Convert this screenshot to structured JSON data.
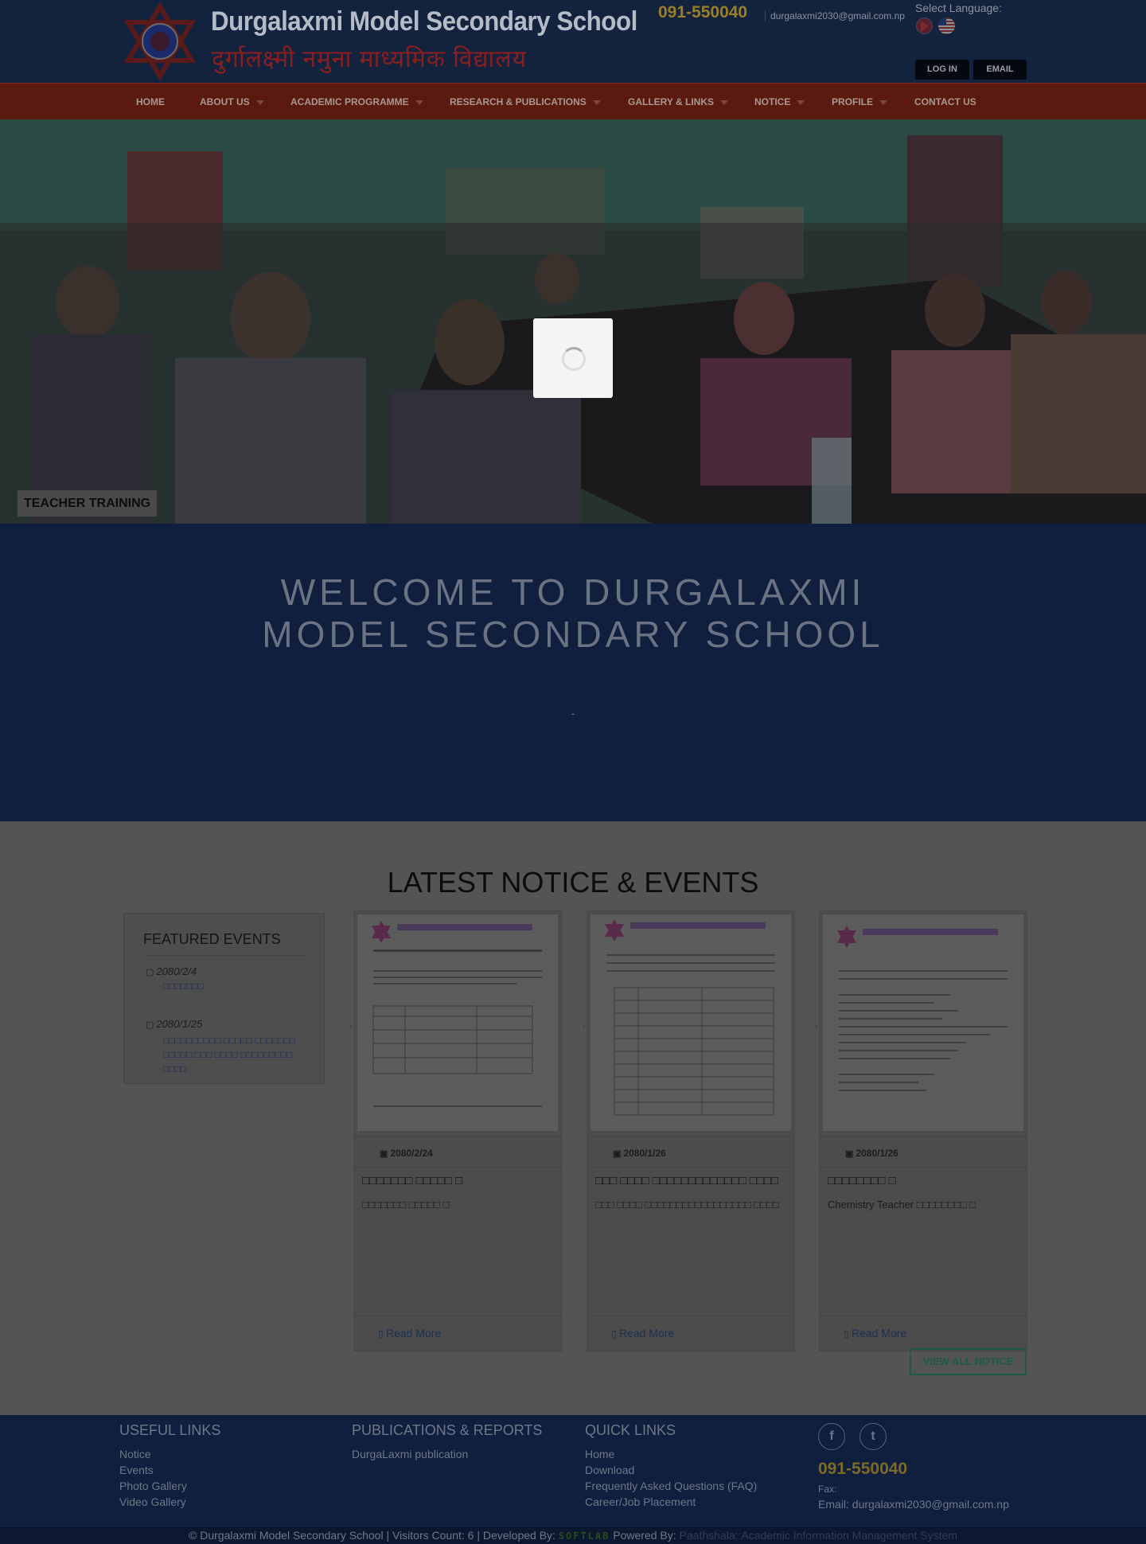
{
  "header": {
    "school_name_en": "Durgalaxmi Model Secondary School",
    "school_name_ne": "दुर्गालक्ष्मी नमुना माध्यमिक विद्यालय",
    "phone": "091-550040",
    "email": "durgalaxmi2030@gmail.com.np",
    "language_label": "Select Language:",
    "login_label": "LOG IN",
    "email_button_label": "EMAIL"
  },
  "nav": {
    "items": [
      {
        "label": "HOME",
        "has_dropdown": false
      },
      {
        "label": "ABOUT US",
        "has_dropdown": true
      },
      {
        "label": "ACADEMIC PROGRAMME",
        "has_dropdown": true
      },
      {
        "label": "RESEARCH & PUBLICATIONS",
        "has_dropdown": true
      },
      {
        "label": "GALLERY & LINKS",
        "has_dropdown": true
      },
      {
        "label": "NOTICE",
        "has_dropdown": true
      },
      {
        "label": "PROFILE",
        "has_dropdown": true
      },
      {
        "label": "CONTACT US",
        "has_dropdown": false
      }
    ]
  },
  "hero": {
    "caption": "TEACHER TRAINING"
  },
  "welcome": {
    "title": "WELCOME TO DURGALAXMI MODEL SECONDARY SCHOOL",
    "subtitle": "-"
  },
  "notices": {
    "section_title": "LATEST NOTICE & EVENTS",
    "featured_title": "FEATURED EVENTS",
    "featured_events": [
      {
        "date": "2080/2/4",
        "text": "□□□□□□□"
      },
      {
        "date": "2080/1/25",
        "text": "□□□□□□□□□□ □□□□□ □□□□□□□ □□□□□ □□□ □□□□ □□□□□□□□□ □□□□"
      }
    ],
    "cards": [
      {
        "date": "2080/2/24",
        "title": "□□□□□□□ □□□□□ □",
        "description": "□□□□□□□ □□□□□ □",
        "read_more": "Read More"
      },
      {
        "date": "2080/1/26",
        "title": "□□□ □□□□ □□□□□□□□□□□□□ □□□□",
        "description": "□□□ □□□□ □□□□□□□□□□□□□□□□□ □□□□",
        "read_more": "Read More"
      },
      {
        "date": "2080/1/26",
        "title": "□□□□□□□□ □",
        "description": "Chemistry Teacher □□□□□□□□ □",
        "read_more": "Read More"
      }
    ],
    "view_all_label": "VIEW ALL NOTICE"
  },
  "footer": {
    "useful_links": {
      "heading": "USEFUL LINKS",
      "links": [
        "Notice",
        "Events",
        "Photo Gallery",
        "Video Gallery"
      ]
    },
    "publications": {
      "heading": "PUBLICATIONS & REPORTS",
      "links": [
        "DurgaLaxmi publication"
      ]
    },
    "quick_links": {
      "heading": "QUICK LINKS",
      "links": [
        "Home",
        "Download",
        "Frequently Asked Questions (FAQ)",
        "Career/Job Placement"
      ]
    },
    "contact": {
      "phone": "091-550040",
      "fax_label": "Fax:",
      "email_line": "Email: durgalaxmi2030@gmail.com.np",
      "social": [
        {
          "icon": "facebook-icon",
          "glyph": "f"
        },
        {
          "icon": "twitter-icon",
          "glyph": "t"
        }
      ]
    },
    "bottom": {
      "copyright": "© Durgalaxmi Model Secondary School | Visitors Count: 6 | Developed By:",
      "developer": "SOFTLAB",
      "powered_by_label": "Powered By:",
      "powered_by_link": "Paathshala::Academic Information Management System"
    }
  }
}
